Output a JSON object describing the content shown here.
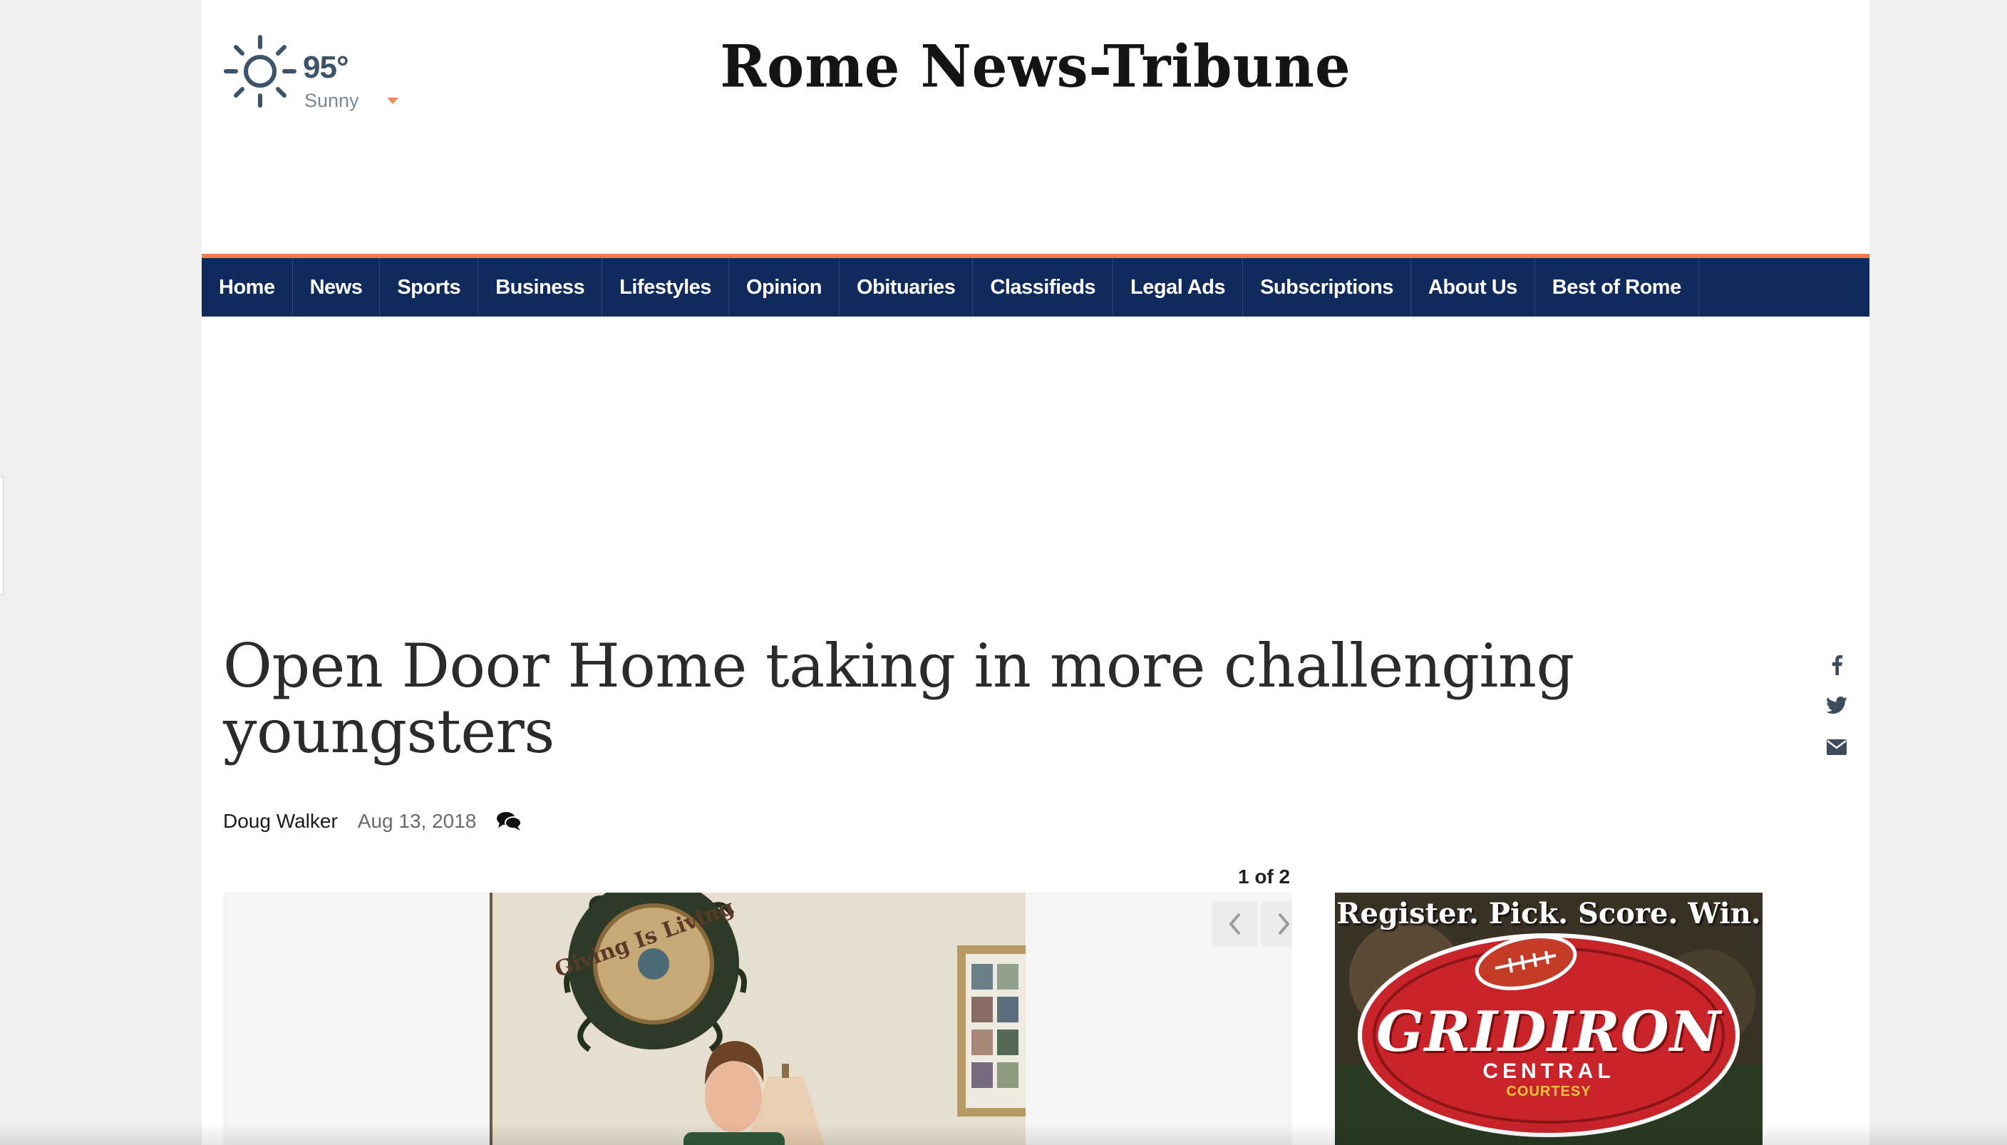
{
  "weather": {
    "temperature": "95°",
    "condition": "Sunny",
    "icon": "sun-icon"
  },
  "masthead": {
    "title": "Rome News-Tribune"
  },
  "nav": {
    "items": [
      "Home",
      "News",
      "Sports",
      "Business",
      "Lifestyles",
      "Opinion",
      "Obituaries",
      "Classifieds",
      "Legal Ads",
      "Subscriptions",
      "About Us",
      "Best of Rome"
    ]
  },
  "colors": {
    "nav_background": "#0f2a5b",
    "nav_accent": "#ef7d4a",
    "weather_caret": "#f08a52"
  },
  "article": {
    "headline": "Open Door Home taking in more challenging youngsters",
    "author": "Doug Walker",
    "date": "Aug 13, 2018",
    "comments_icon": "comments-icon"
  },
  "social": [
    "facebook-icon",
    "twitter-icon",
    "email-icon"
  ],
  "gallery": {
    "counter": "1 of 2",
    "sign_text": "Giving Is Living"
  },
  "ad": {
    "tagline": "Register. Pick. Score. Win.",
    "title": "GRIDIRON",
    "subtitle": "CENTRAL",
    "courtesy": "COURTESY"
  }
}
